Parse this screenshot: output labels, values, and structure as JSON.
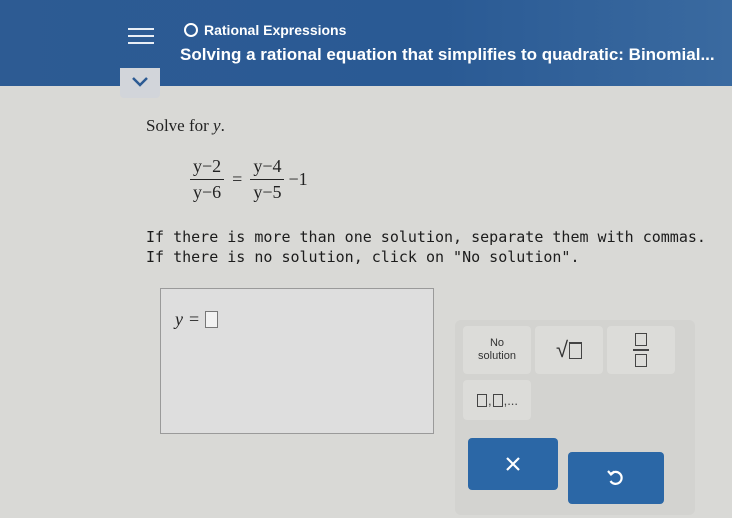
{
  "header": {
    "topic": "Rational Expressions",
    "title": "Solving a rational equation that simplifies to quadratic: Binomial...",
    "menu_icon": "hamburger-icon",
    "collapse_icon": "chevron-down-icon"
  },
  "question": {
    "prompt_text": "Solve for",
    "prompt_var": "y",
    "prompt_end": ".",
    "eq": {
      "lhs_num": "y−2",
      "lhs_den": "y−6",
      "equals": "=",
      "rhs_num": "y−4",
      "rhs_den": "y−5",
      "tail": "−1"
    },
    "instruction1": "If there is more than one solution, separate them with commas.",
    "instruction2": "If there is no solution, click on \"No solution\"."
  },
  "answer": {
    "var": "y",
    "equals": "=",
    "value": ""
  },
  "keypad": {
    "no_solution_line1": "No",
    "no_solution_line2": "solution",
    "sqrt_symbol": "√",
    "list_suffix": ",..."
  },
  "actions": {
    "clear_icon": "x-icon",
    "undo_icon": "undo-icon"
  },
  "colors": {
    "header_bg": "#2d5b93",
    "button_bg": "#2b67a6"
  }
}
